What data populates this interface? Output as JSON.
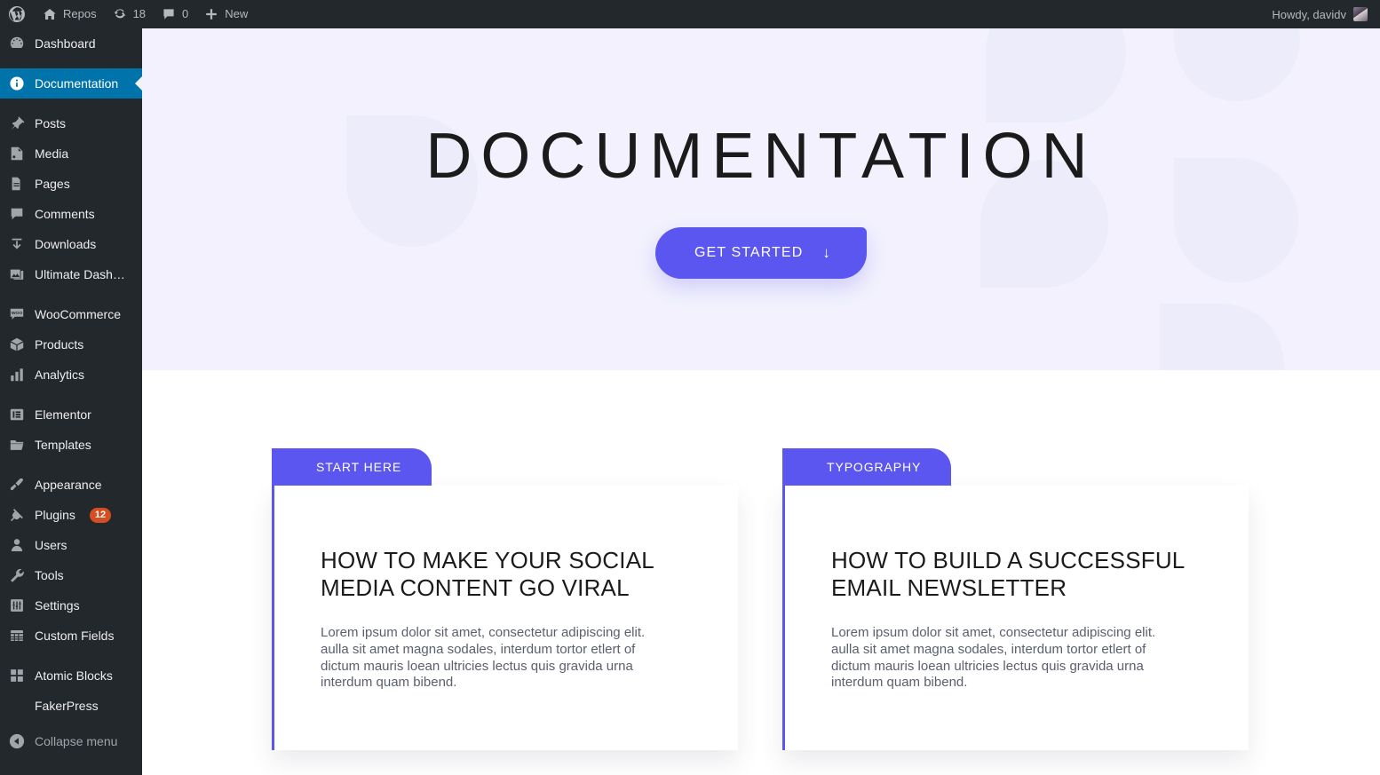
{
  "adminbar": {
    "logo_icon": "wordpress-logo-icon",
    "site_name": "Repos",
    "site_icon": "home-icon",
    "updates_icon": "updates-icon",
    "updates_count": "18",
    "comments_icon": "comment-bubble-icon",
    "comments_count": "0",
    "new_icon": "plus-icon",
    "new_label": "New",
    "howdy": "Howdy, davidv"
  },
  "sidebar": {
    "items": [
      {
        "label": "Dashboard",
        "icon": "dashboard-icon",
        "active": false,
        "sep_after": true
      },
      {
        "label": "Documentation",
        "icon": "info-icon",
        "active": true,
        "sep_after": true
      },
      {
        "label": "Posts",
        "icon": "pin-icon",
        "active": false,
        "sep_after": false
      },
      {
        "label": "Media",
        "icon": "media-icon",
        "active": false,
        "sep_after": false
      },
      {
        "label": "Pages",
        "icon": "pages-icon",
        "active": false,
        "sep_after": false
      },
      {
        "label": "Comments",
        "icon": "comment-bubble-icon",
        "active": false,
        "sep_after": false
      },
      {
        "label": "Downloads",
        "icon": "download-icon",
        "active": false,
        "sep_after": false
      },
      {
        "label": "Ultimate Dash…",
        "icon": "images-icon",
        "active": false,
        "sep_after": true
      },
      {
        "label": "WooCommerce",
        "icon": "woocommerce-icon",
        "active": false,
        "sep_after": false
      },
      {
        "label": "Products",
        "icon": "box-icon",
        "active": false,
        "sep_after": false
      },
      {
        "label": "Analytics",
        "icon": "bar-chart-icon",
        "active": false,
        "sep_after": true
      },
      {
        "label": "Elementor",
        "icon": "elementor-icon",
        "active": false,
        "sep_after": false
      },
      {
        "label": "Templates",
        "icon": "folder-icon",
        "active": false,
        "sep_after": true
      },
      {
        "label": "Appearance",
        "icon": "paintbrush-icon",
        "active": false,
        "sep_after": false
      },
      {
        "label": "Plugins",
        "icon": "plug-icon",
        "active": false,
        "sep_after": false,
        "badge": "12"
      },
      {
        "label": "Users",
        "icon": "user-icon",
        "active": false,
        "sep_after": false
      },
      {
        "label": "Tools",
        "icon": "wrench-icon",
        "active": false,
        "sep_after": false
      },
      {
        "label": "Settings",
        "icon": "settings-icon",
        "active": false,
        "sep_after": false
      },
      {
        "label": "Custom Fields",
        "icon": "table-icon",
        "active": false,
        "sep_after": true
      },
      {
        "label": "Atomic Blocks",
        "icon": "blocks-icon",
        "active": false,
        "sep_after": false
      },
      {
        "label": "FakerPress",
        "icon": "none",
        "active": false,
        "sep_after": false,
        "no_icon": true
      }
    ],
    "collapse": {
      "label": "Collapse menu",
      "icon": "collapse-arrow-icon"
    }
  },
  "hero": {
    "title": "DOCUMENTATION",
    "cta_label": "GET STARTED",
    "cta_arrow": "↓",
    "background_color": "#f2f1fd",
    "accent_color": "#5c56f0"
  },
  "cards": [
    {
      "badge": "START HERE",
      "title": "HOW TO MAKE YOUR SOCIAL MEDIA CONTENT GO VIRAL",
      "text": "Lorem ipsum dolor sit amet, consectetur adipiscing elit. aulla sit amet magna sodales, interdum tortor etlert of dictum mauris loean ultricies lectus quis gravida urna interdum quam bibend."
    },
    {
      "badge": "TYPOGRAPHY",
      "title": "HOW TO BUILD A SUCCESSFUL EMAIL NEWSLETTER",
      "text": "Lorem ipsum dolor sit amet, consectetur adipiscing elit. aulla sit amet magna sodales, interdum tortor etlert of dictum mauris loean ultricies lectus quis gravida urna interdum quam bibend."
    }
  ]
}
